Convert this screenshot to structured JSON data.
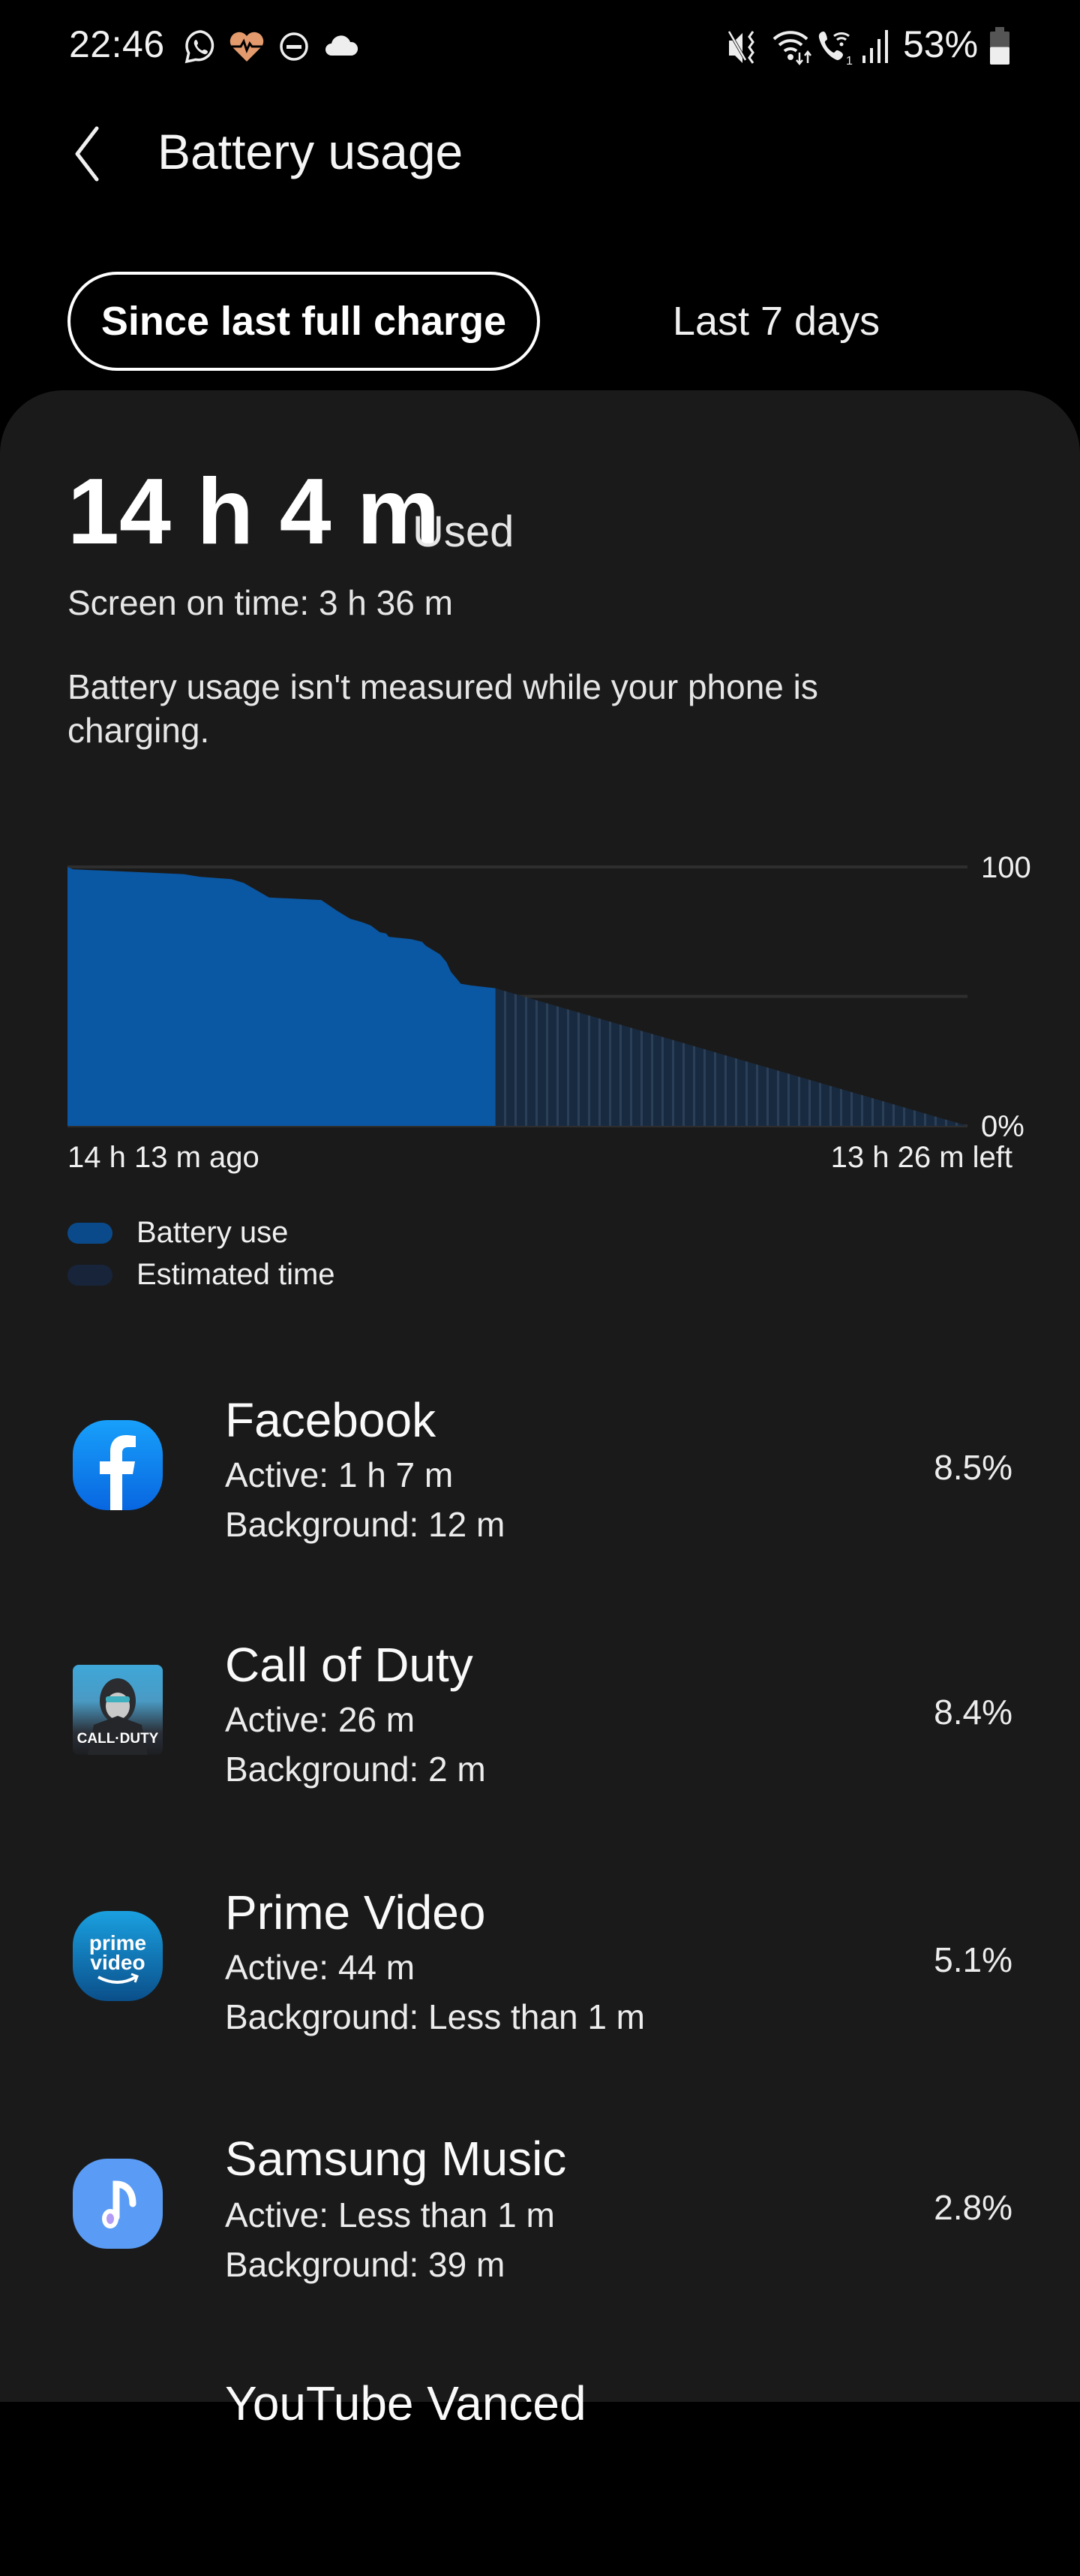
{
  "status_bar": {
    "time": "22:46",
    "left_icons": [
      "whatsapp-icon",
      "health-heart-icon",
      "do-not-disturb-icon",
      "cloud-icon"
    ],
    "right_icons": [
      "vibrate-mute-icon",
      "wifi-data-icon",
      "wifi-calling-icon",
      "signal-icon"
    ],
    "battery_percent": "53%",
    "battery_level": 0.53
  },
  "header": {
    "title": "Battery usage",
    "back_icon": "chevron-left-icon"
  },
  "tabs": [
    {
      "label": "Since last full charge",
      "selected": true
    },
    {
      "label": "Last 7 days",
      "selected": false
    }
  ],
  "summary": {
    "total_used": "14 h 4 m",
    "used_label": "Used",
    "screen_on": "Screen on time: 3 h 36 m",
    "note": "Battery usage isn't measured while your phone is charging."
  },
  "chart_data": {
    "type": "area",
    "title": "",
    "xlabel": "",
    "ylabel": "",
    "x_start_label": "14 h 13 m ago",
    "x_end_label": "13 h 26 m left",
    "y_tick_labels": [
      "100",
      "0%"
    ],
    "ylim": [
      0,
      100
    ],
    "gridlines": [
      0,
      50,
      100
    ],
    "legend": [
      {
        "name": "Battery use",
        "color": "#0a57a3"
      },
      {
        "name": "Estimated time",
        "color": "#1a2a3d"
      }
    ],
    "legend_placement": "bottom-left",
    "x_unit": "fraction of timeline (0 = full charge, 1 = battery empty)",
    "series": [
      {
        "name": "Battery use",
        "color": "#0a57a3",
        "points": [
          [
            0.0,
            100.0
          ],
          [
            0.006,
            99.1
          ],
          [
            0.129,
            97.2
          ],
          [
            0.147,
            96.2
          ],
          [
            0.182,
            95.3
          ],
          [
            0.196,
            93.8
          ],
          [
            0.213,
            90.4
          ],
          [
            0.224,
            88.2
          ],
          [
            0.282,
            87.2
          ],
          [
            0.299,
            83.2
          ],
          [
            0.314,
            80.0
          ],
          [
            0.328,
            78.6
          ],
          [
            0.337,
            77.4
          ],
          [
            0.347,
            74.8
          ],
          [
            0.354,
            74.3
          ],
          [
            0.357,
            73.0
          ],
          [
            0.382,
            72.1
          ],
          [
            0.394,
            71.1
          ],
          [
            0.398,
            69.6
          ],
          [
            0.414,
            66.2
          ],
          [
            0.421,
            63.3
          ],
          [
            0.426,
            59.5
          ],
          [
            0.433,
            56.6
          ],
          [
            0.437,
            54.9
          ],
          [
            0.449,
            54.2
          ],
          [
            0.475,
            53.2
          ]
        ]
      },
      {
        "name": "Estimated time",
        "color": "#1a2a3d",
        "points": [
          [
            0.475,
            53.2
          ],
          [
            1.0,
            0.0
          ]
        ]
      }
    ]
  },
  "apps": [
    {
      "name": "Facebook",
      "active": "Active: 1 h 7 m",
      "background": "Background: 12 m",
      "percent": "8.5%",
      "icon": "facebook-icon"
    },
    {
      "name": "Call of Duty",
      "active": "Active: 26 m",
      "background": "Background: 2 m",
      "percent": "8.4%",
      "icon": "call-of-duty-icon",
      "icon_text": "CALL·DUTY"
    },
    {
      "name": "Prime Video",
      "active": "Active: 44 m",
      "background": "Background: Less than 1 m",
      "percent": "5.1%",
      "icon": "prime-video-icon",
      "icon_text_1": "prime",
      "icon_text_2": "video"
    },
    {
      "name": "Samsung Music",
      "active": "Active: Less than 1 m",
      "background": "Background: 39 m",
      "percent": "2.8%",
      "icon": "samsung-music-icon"
    },
    {
      "name": "YouTube Vanced",
      "icon": "youtube-vanced-icon"
    }
  ]
}
